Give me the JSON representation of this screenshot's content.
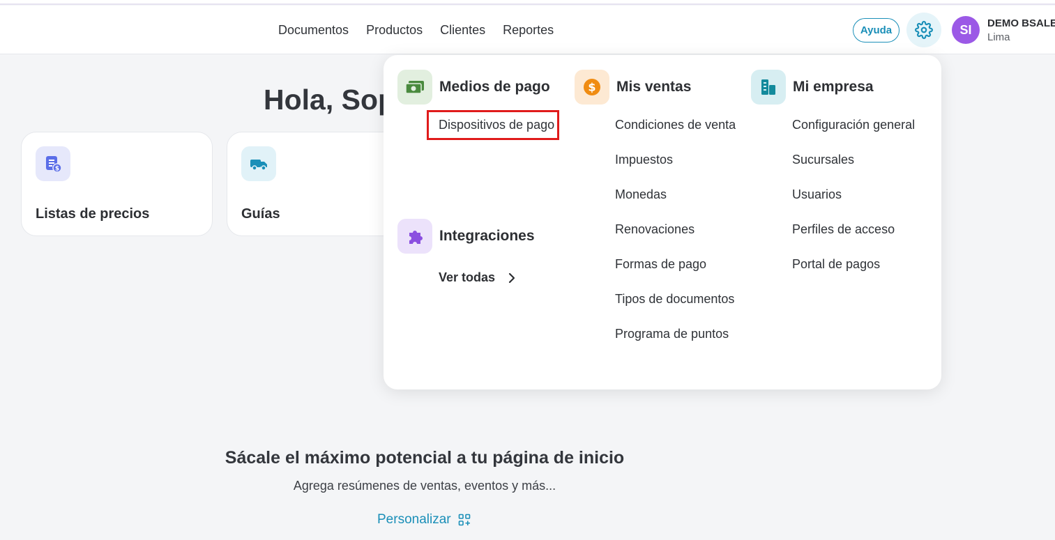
{
  "header": {
    "nav": [
      "Documentos",
      "Productos",
      "Clientes",
      "Reportes"
    ],
    "help_label": "Ayuda",
    "user_initials": "SI",
    "company_name": "DEMO BSALE",
    "company_city": "Lima"
  },
  "main": {
    "greeting": "Hola, Sop",
    "cards": [
      {
        "label": "Listas de precios",
        "icon": "price-list-icon"
      },
      {
        "label": "Guías",
        "icon": "truck-icon"
      }
    ],
    "promo_title": "Sácale el máximo potencial a tu página de inicio",
    "promo_subtitle": "Agrega resúmenes de ventas, eventos y más...",
    "personalize_label": "Personalizar"
  },
  "dropdown": {
    "payment_methods": {
      "title": "Medios de pago",
      "items": [
        "Dispositivos de pago"
      ]
    },
    "integrations": {
      "title": "Integraciones",
      "see_all": "Ver todas"
    },
    "my_sales": {
      "title": "Mis ventas",
      "items": [
        "Condiciones de venta",
        "Impuestos",
        "Monedas",
        "Renovaciones",
        "Formas de pago",
        "Tipos de documentos",
        "Programa de puntos"
      ]
    },
    "my_company": {
      "title": "Mi empresa",
      "items": [
        "Configuración general",
        "Sucursales",
        "Usuarios",
        "Perfiles de acceso",
        "Portal de pagos"
      ]
    }
  },
  "colors": {
    "accent": "#1a8fb8",
    "avatar": "#9b59e6",
    "highlight": "#e01b1b"
  }
}
